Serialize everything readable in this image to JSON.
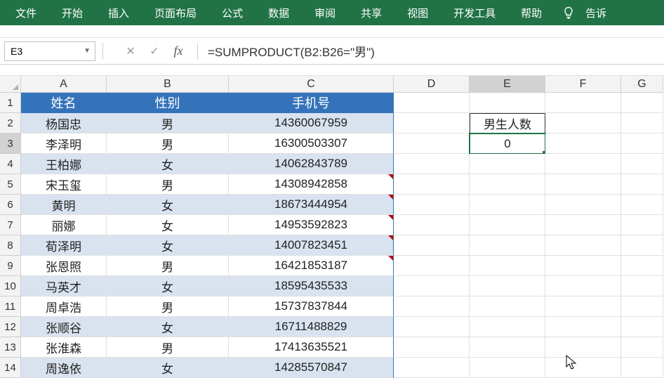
{
  "ribbon": {
    "tabs": [
      "文件",
      "开始",
      "插入",
      "页面布局",
      "公式",
      "数据",
      "审阅",
      "共享",
      "视图",
      "开发工具",
      "帮助"
    ],
    "tell": "告诉"
  },
  "namebox": "E3",
  "fx_label": "fx",
  "formula": "=SUMPRODUCT(B2:B26=\"男\")",
  "columns": [
    "A",
    "B",
    "C",
    "D",
    "E",
    "F",
    "G"
  ],
  "row_nums": [
    "1",
    "2",
    "3",
    "4",
    "5",
    "6",
    "7",
    "8",
    "9",
    "10",
    "11",
    "12",
    "13",
    "14"
  ],
  "headers": {
    "A": "姓名",
    "B": "性别",
    "C": "手机号"
  },
  "e2": "男生人数",
  "e3": "0",
  "table": [
    {
      "name": "杨国忠",
      "sex": "男",
      "phone": "14360067959"
    },
    {
      "name": "李泽明",
      "sex": "男",
      "phone": "16300503307"
    },
    {
      "name": "王柏娜",
      "sex": "女",
      "phone": "14062843789"
    },
    {
      "name": "宋玉玺",
      "sex": "男",
      "phone": "14308942858"
    },
    {
      "name": "黄明",
      "sex": "女",
      "phone": "18673444954"
    },
    {
      "name": "丽娜",
      "sex": "女",
      "phone": "14953592823"
    },
    {
      "name": "荀泽明",
      "sex": "女",
      "phone": "14007823451"
    },
    {
      "name": "张恩照",
      "sex": "男",
      "phone": "16421853187"
    },
    {
      "name": "马英才",
      "sex": "女",
      "phone": "18595435533"
    },
    {
      "name": "周卓浩",
      "sex": "男",
      "phone": "15737837844"
    },
    {
      "name": "张顺谷",
      "sex": "女",
      "phone": "16711488829"
    },
    {
      "name": "张淮森",
      "sex": "男",
      "phone": "17413635521"
    },
    {
      "name": "周逸依",
      "sex": "女",
      "phone": "14285570847"
    }
  ],
  "red_mark_rows": [
    5,
    6,
    7,
    8,
    9
  ]
}
